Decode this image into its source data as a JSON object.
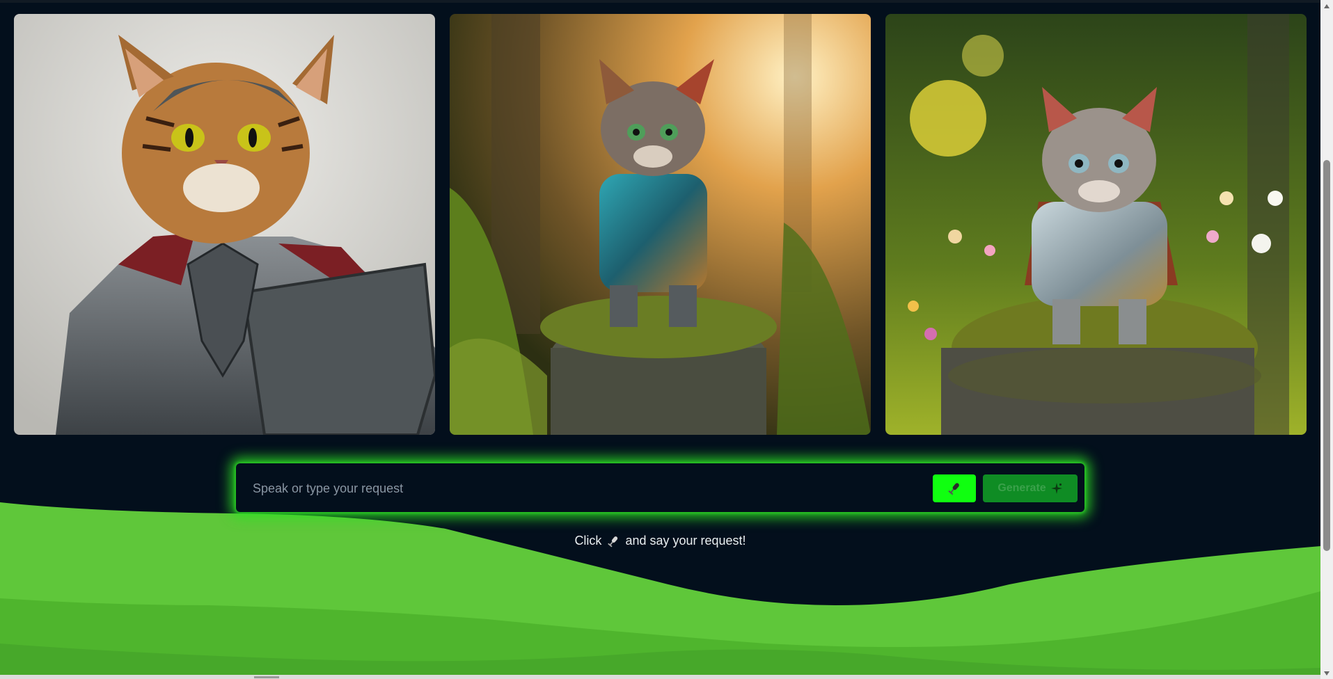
{
  "gallery": {
    "images": [
      {
        "subject": "portrait of tabby cat in steel knight armor with helmet and shield",
        "colors": {
          "bg": "#d9d8d3",
          "fur": "#b87a3c",
          "armor": "#6f7478"
        }
      },
      {
        "subject": "kitten in iridescent knight armor standing on mossy stone in sunlit forest",
        "colors": {
          "bg": "#8b6a2c",
          "light": "#f4c466",
          "armor": "#2f8f9b"
        }
      },
      {
        "subject": "kitten in ornate silver armor with red cape on mossy stump among wildflowers",
        "colors": {
          "bg": "#3e5e21",
          "light": "#e8e35a",
          "armor": "#a7bcc4"
        }
      }
    ]
  },
  "prompt": {
    "placeholder": "Speak or type your request",
    "value": "",
    "mic_icon": "microphone-icon",
    "generate_label": "Generate",
    "generate_icon": "sparkle-icon",
    "glow_color": "#2fe523"
  },
  "hint": {
    "prefix": "Click",
    "icon": "microphone-icon",
    "suffix": "and say your request!"
  },
  "theme": {
    "background": "#030f1c",
    "wave_light": "#5fc73a",
    "wave_mid": "#4bb02a",
    "wave_dark": "#3f9f22",
    "mic_button": "#10ff10",
    "generate_button": "#0f8c24"
  }
}
